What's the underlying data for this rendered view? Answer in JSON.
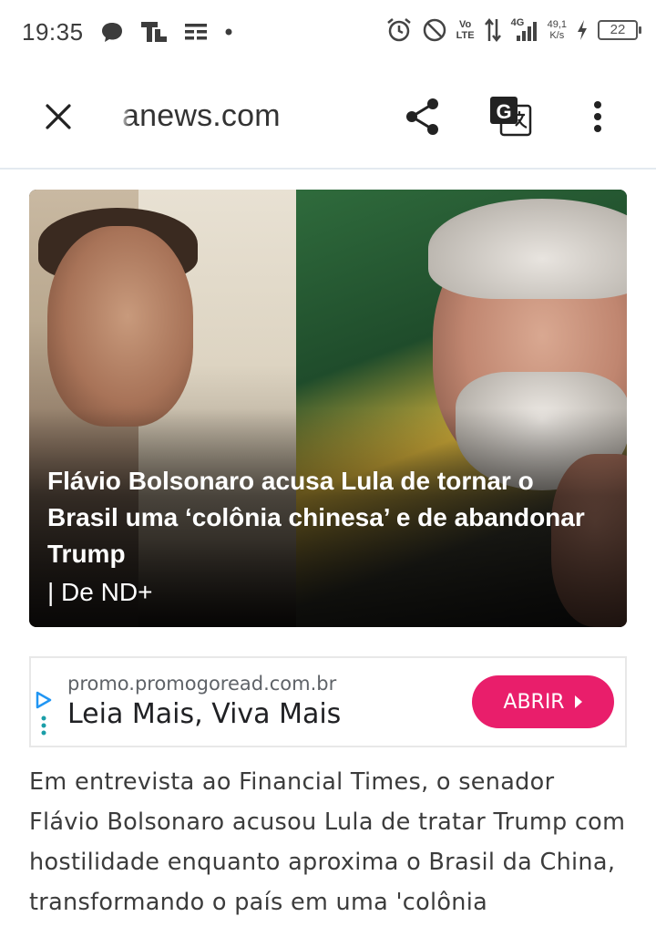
{
  "status_bar": {
    "time": "19:35",
    "network_top": "Vo",
    "network_bottom": "LTE",
    "signal_type": "4G",
    "speed_value": "49,1",
    "speed_unit": "K/s",
    "battery": "22"
  },
  "toolbar": {
    "url": "anews.com"
  },
  "hero": {
    "title": "Flávio Bolsonaro acusa Lula de tornar o Brasil uma ‘colônia chinesa’ e de abandonar Trump",
    "source": "| De ND+"
  },
  "ad": {
    "domain": "promo.promogoread.com.br",
    "headline": "Leia Mais, Viva Mais",
    "button_label": "ABRIR",
    "colors": {
      "button": "#e91e6b",
      "adchoices": "#2196f3"
    }
  },
  "article": {
    "paragraph": "Em entrevista ao Financial Times, o senador Flávio Bolsonaro acusou Lula de tratar Trump com hostilidade enquanto aproxima o Brasil da China, transformando o país em uma 'colônia"
  }
}
